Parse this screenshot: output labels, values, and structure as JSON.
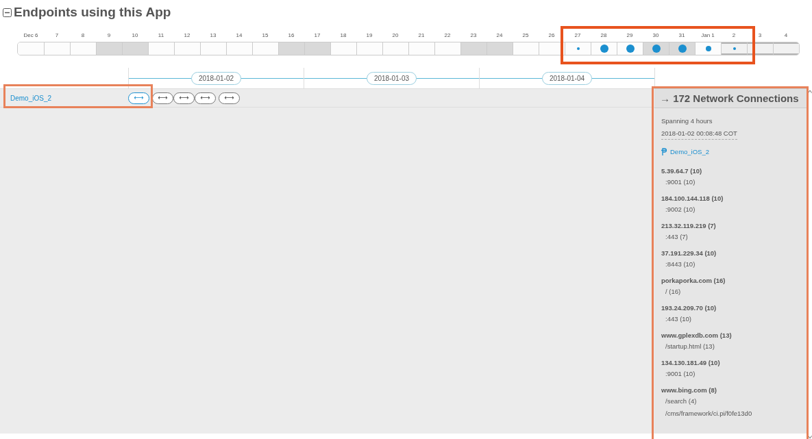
{
  "section": {
    "title": "Endpoints using this App",
    "expanded": true
  },
  "days": [
    {
      "label": "Dec 6",
      "weekend": false,
      "kind": "none",
      "in_window": false
    },
    {
      "label": "7",
      "weekend": false,
      "kind": "none",
      "in_window": false
    },
    {
      "label": "8",
      "weekend": false,
      "kind": "none",
      "in_window": false
    },
    {
      "label": "9",
      "weekend": true,
      "kind": "none",
      "in_window": false
    },
    {
      "label": "10",
      "weekend": true,
      "kind": "none",
      "in_window": false
    },
    {
      "label": "11",
      "weekend": false,
      "kind": "none",
      "in_window": false
    },
    {
      "label": "12",
      "weekend": false,
      "kind": "none",
      "in_window": false
    },
    {
      "label": "13",
      "weekend": false,
      "kind": "none",
      "in_window": false
    },
    {
      "label": "14",
      "weekend": false,
      "kind": "none",
      "in_window": false
    },
    {
      "label": "15",
      "weekend": false,
      "kind": "none",
      "in_window": false
    },
    {
      "label": "16",
      "weekend": true,
      "kind": "none",
      "in_window": false
    },
    {
      "label": "17",
      "weekend": true,
      "kind": "none",
      "in_window": false
    },
    {
      "label": "18",
      "weekend": false,
      "kind": "none",
      "in_window": false
    },
    {
      "label": "19",
      "weekend": false,
      "kind": "none",
      "in_window": false
    },
    {
      "label": "20",
      "weekend": false,
      "kind": "none",
      "in_window": false
    },
    {
      "label": "21",
      "weekend": false,
      "kind": "none",
      "in_window": false
    },
    {
      "label": "22",
      "weekend": false,
      "kind": "none",
      "in_window": false
    },
    {
      "label": "23",
      "weekend": true,
      "kind": "none",
      "in_window": false
    },
    {
      "label": "24",
      "weekend": true,
      "kind": "none",
      "in_window": false
    },
    {
      "label": "25",
      "weekend": false,
      "kind": "none",
      "in_window": false
    },
    {
      "label": "26",
      "weekend": false,
      "kind": "none",
      "in_window": false
    },
    {
      "label": "27",
      "weekend": false,
      "kind": "small",
      "in_window": false
    },
    {
      "label": "28",
      "weekend": false,
      "kind": "large",
      "in_window": false
    },
    {
      "label": "29",
      "weekend": false,
      "kind": "large",
      "in_window": false
    },
    {
      "label": "30",
      "weekend": true,
      "kind": "large",
      "in_window": false
    },
    {
      "label": "31",
      "weekend": true,
      "kind": "large",
      "in_window": false
    },
    {
      "label": "Jan 1",
      "weekend": false,
      "kind": "medium",
      "in_window": false
    },
    {
      "label": "2",
      "weekend": false,
      "kind": "small",
      "in_window": true
    },
    {
      "label": "3",
      "weekend": false,
      "kind": "none",
      "in_window": true
    },
    {
      "label": "4",
      "weekend": false,
      "kind": "none",
      "in_window": true
    }
  ],
  "axis_dates": [
    "2018-01-02",
    "2018-01-03",
    "2018-01-04"
  ],
  "endpoints": [
    {
      "name": "Demo_iOS_2",
      "connections": [
        {
          "label": "⟷",
          "selected": true
        },
        {
          "label": "⟷",
          "selected": false
        },
        {
          "label": "⟷",
          "selected": false
        },
        {
          "label": "⟷",
          "selected": false
        },
        {
          "label": "⟷",
          "selected": false
        }
      ]
    }
  ],
  "details": {
    "title": "→ 172 Network Connections",
    "span": "Spanning 4 hours",
    "timestamp": "2018-01-02 00:08:48 COT",
    "endpoint": "Demo_iOS_2",
    "hosts": [
      {
        "host": "5.39.64.7 (10)",
        "paths": [
          ":9001 (10)"
        ]
      },
      {
        "host": "184.100.144.118 (10)",
        "paths": [
          ":9002 (10)"
        ]
      },
      {
        "host": "213.32.119.219 (7)",
        "paths": [
          ":443 (7)"
        ]
      },
      {
        "host": "37.191.229.34 (10)",
        "paths": [
          ":8443 (10)"
        ]
      },
      {
        "host": "porkaporka.com (16)",
        "paths": [
          "/ (16)"
        ]
      },
      {
        "host": "193.24.209.70 (10)",
        "paths": [
          ":443 (10)"
        ]
      },
      {
        "host": "www.gplexdb.com (13)",
        "paths": [
          "/startup.html (13)"
        ]
      },
      {
        "host": "134.130.181.49 (10)",
        "paths": [
          ":9001 (10)"
        ]
      },
      {
        "host": "www.bing.com (8)",
        "paths": [
          "/search (4)",
          "/cms/framework/ci.pi/f0fe13d0"
        ]
      }
    ]
  }
}
